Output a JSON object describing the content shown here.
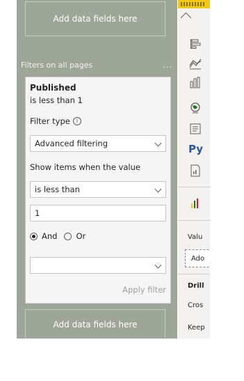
{
  "filters_pane": {
    "dropzone_top": "Add data fields here",
    "section_title": "Filters on all pages",
    "more_options": "...",
    "dropzone_bottom": "Add data fields here"
  },
  "filter_card": {
    "field_name": "Published",
    "summary": "is less than 1",
    "filter_type_label": "Filter type",
    "filter_type_value": "Advanced filtering",
    "show_items_label": "Show items when the value",
    "operator_value": "is less than",
    "value_input": "1",
    "logic_and": "And",
    "logic_or": "Or",
    "logic_selected": "And",
    "second_operator_value": "",
    "apply_button": "Apply filter"
  },
  "visualizations_pane": {
    "icons": [
      "table-chart-icon",
      "bar-chart-icon",
      "line-chart-icon",
      "stacked-column-icon",
      "globe-icon",
      "report-page-icon",
      "python-visual-icon",
      "document-icon",
      "multi-bar-icon"
    ],
    "python_label": "Py",
    "values_label": "Valu",
    "add_label": "Ado",
    "drill_label": "Drill",
    "cross_label": "Cros",
    "keep_label": "Keep"
  },
  "colors": {
    "pane_background": "#9ea69a",
    "card_background": "#f5f5f5",
    "accent_yellow": "#f2c811",
    "python_blue": "#2b579a"
  }
}
